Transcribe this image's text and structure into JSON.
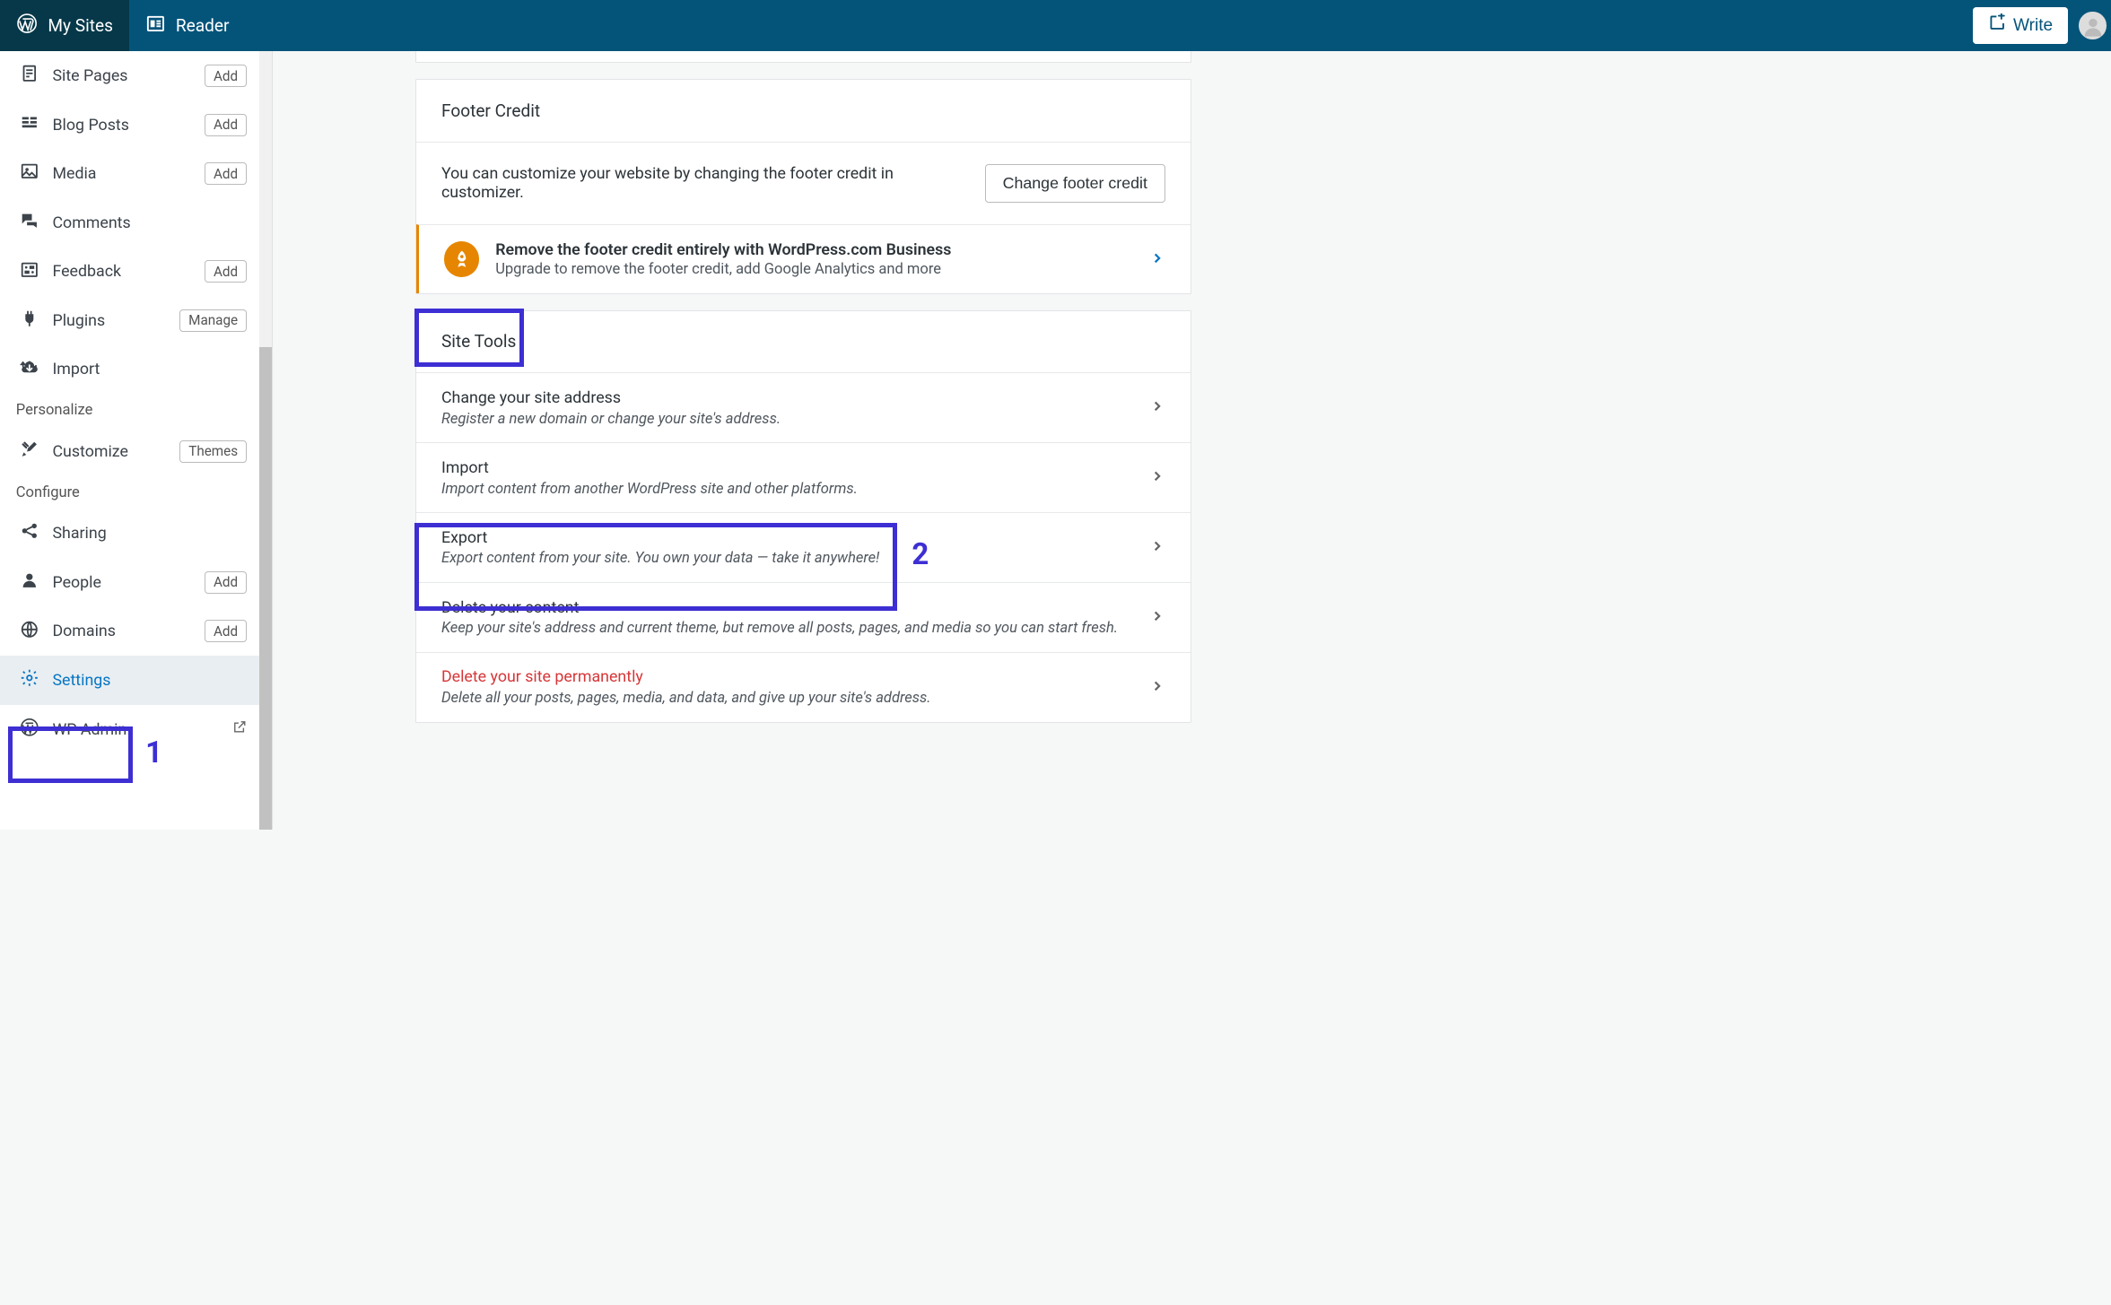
{
  "topbar": {
    "my_sites": "My Sites",
    "reader": "Reader",
    "write": "Write"
  },
  "sidebar": {
    "items": [
      {
        "label": "Site Pages",
        "action": "Add"
      },
      {
        "label": "Blog Posts",
        "action": "Add"
      },
      {
        "label": "Media",
        "action": "Add"
      },
      {
        "label": "Comments",
        "action": ""
      },
      {
        "label": "Feedback",
        "action": "Add"
      },
      {
        "label": "Plugins",
        "action": "Manage"
      },
      {
        "label": "Import",
        "action": ""
      }
    ],
    "personalize_label": "Personalize",
    "personalize": [
      {
        "label": "Customize",
        "action": "Themes"
      }
    ],
    "configure_label": "Configure",
    "configure": [
      {
        "label": "Sharing",
        "action": ""
      },
      {
        "label": "People",
        "action": "Add"
      },
      {
        "label": "Domains",
        "action": "Add"
      },
      {
        "label": "Settings",
        "action": ""
      },
      {
        "label": "WP Admin",
        "action": ""
      }
    ]
  },
  "annotations": {
    "n1": "1",
    "n2": "2"
  },
  "main": {
    "footer_card": {
      "title": "Footer Credit",
      "body": "You can customize your website by changing the footer credit in customizer.",
      "button": "Change footer credit",
      "upsell_title": "Remove the footer credit entirely with WordPress.com Business",
      "upsell_sub": "Upgrade to remove the footer credit, add Google Analytics and more"
    },
    "tools_card": {
      "title": "Site Tools",
      "rows": [
        {
          "title": "Change your site address",
          "sub": "Register a new domain or change your site's address."
        },
        {
          "title": "Import",
          "sub": "Import content from another WordPress site and other platforms."
        },
        {
          "title": "Export",
          "sub": "Export content from your site. You own your data — take it anywhere!"
        },
        {
          "title": "Delete your content",
          "sub": "Keep your site's address and current theme, but remove all posts, pages, and media so you can start fresh."
        },
        {
          "title": "Delete your site permanently",
          "sub": "Delete all your posts, pages, media, and data, and give up your site's address.",
          "danger": true
        }
      ]
    }
  }
}
